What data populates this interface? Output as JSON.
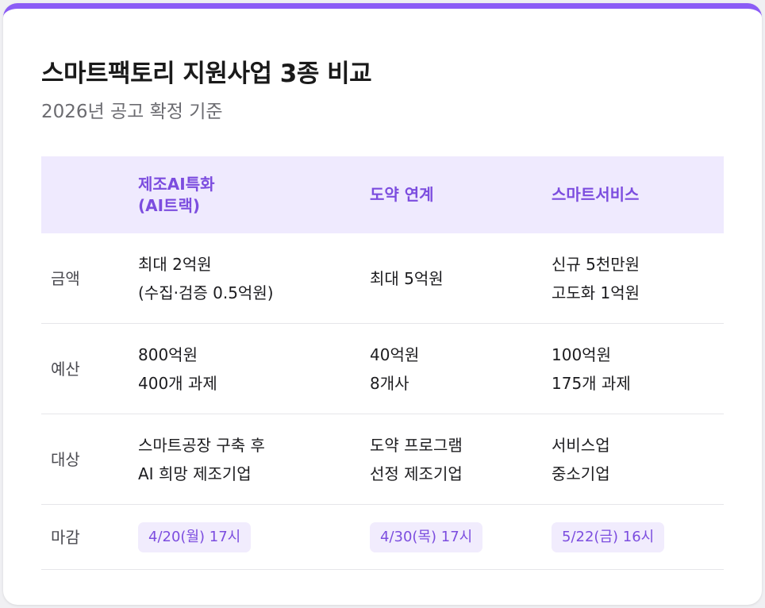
{
  "header": {
    "title": "스마트팩토리 지원사업 3종 비교",
    "subtitle": "2026년 공고 확정 기준"
  },
  "accent_color": "#8b5cf6",
  "columns": [
    {
      "line1": "",
      "line2": ""
    },
    {
      "line1": "제조AI특화",
      "line2": "(AI트랙)"
    },
    {
      "line1": "도약 연계",
      "line2": ""
    },
    {
      "line1": "스마트서비스",
      "line2": ""
    }
  ],
  "rows": [
    {
      "label": "금액",
      "cells": [
        {
          "line1": "최대 2억원",
          "line2": "(수집·검증 0.5억원)"
        },
        {
          "line1": "최대 5억원",
          "line2": ""
        },
        {
          "line1": "신규 5천만원",
          "line2": "고도화 1억원"
        }
      ]
    },
    {
      "label": "예산",
      "cells": [
        {
          "line1": "800억원",
          "line2": "400개 과제"
        },
        {
          "line1": "40억원",
          "line2": "8개사"
        },
        {
          "line1": "100억원",
          "line2": "175개 과제"
        }
      ]
    },
    {
      "label": "대상",
      "cells": [
        {
          "line1": "스마트공장 구축 후",
          "line2": "AI 희망 제조기업"
        },
        {
          "line1": "도약 프로그램",
          "line2": "선정 제조기업"
        },
        {
          "line1": "서비스업",
          "line2": "중소기업"
        }
      ]
    }
  ],
  "deadline": {
    "label": "마감",
    "values": [
      "4/20(월) 17시",
      "4/30(목) 17시",
      "5/22(금) 16시"
    ]
  }
}
